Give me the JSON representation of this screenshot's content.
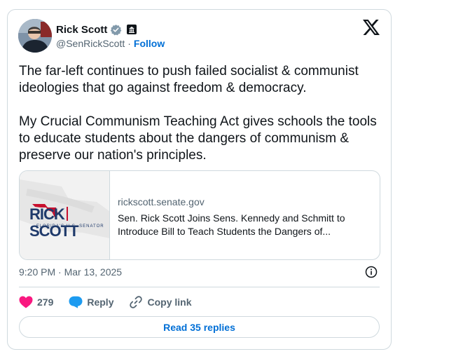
{
  "author": {
    "display_name": "Rick Scott",
    "handle": "@SenRickScott",
    "separator": "·",
    "follow_label": "Follow"
  },
  "tweet": {
    "text": "The far-left continues to push failed socialist & communist ideologies that go against freedom & democracy.\n\nMy Crucial Communism Teaching Act gives schools the tools to educate students about the dangers of communism & preserve our nation's principles.",
    "timestamp": "9:20 PM · Mar 13, 2025"
  },
  "link_card": {
    "logo_text_left": "RICK",
    "logo_text_right": "SCOTT",
    "logo_subtitle": "FLORIDA'S U.S. SENATOR",
    "domain": "rickscott.senate.gov",
    "title": "Sen. Rick Scott Joins Sens. Kennedy and Schmitt to Introduce Bill to Teach Students the Dangers of..."
  },
  "actions": {
    "like_count": "279",
    "reply_label": "Reply",
    "copy_link_label": "Copy link"
  },
  "read_replies_label": "Read 35 replies",
  "colors": {
    "accent": "#006fd6",
    "like": "#f91880",
    "reply": "#1d9bf0",
    "border": "#cfd9de",
    "muted": "#536471",
    "logo_red": "#c8102e",
    "logo_navy": "#1f3a6b"
  },
  "icons": [
    "verified-badge-icon",
    "government-badge-icon",
    "x-logo-icon",
    "info-icon",
    "heart-icon",
    "reply-bubble-icon",
    "link-icon"
  ]
}
